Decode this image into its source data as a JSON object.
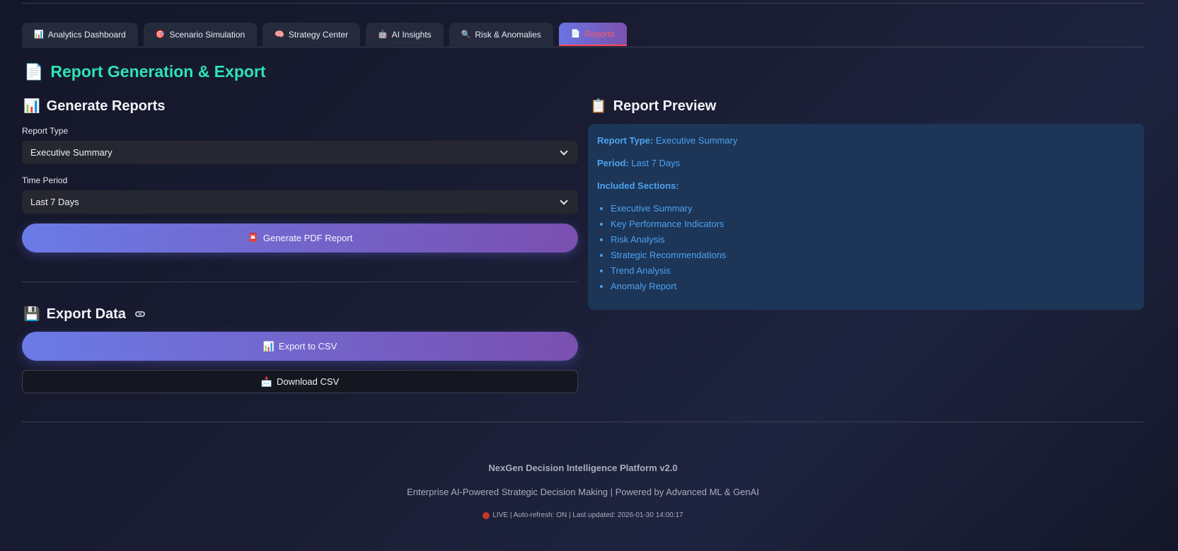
{
  "tabs": [
    {
      "icon": "📊",
      "label": "Analytics Dashboard"
    },
    {
      "icon": "🎯",
      "label": "Scenario Simulation"
    },
    {
      "icon": "🧠",
      "label": "Strategy Center"
    },
    {
      "icon": "🤖",
      "label": "AI Insights"
    },
    {
      "icon": "🔍",
      "label": "Risk & Anomalies"
    },
    {
      "icon": "📄",
      "label": "Reports"
    }
  ],
  "page_title": {
    "icon": "📄",
    "text": "Report Generation & Export"
  },
  "generate": {
    "heading_icon": "📊",
    "heading": "Generate Reports",
    "report_type_label": "Report Type",
    "report_type_value": "Executive Summary",
    "time_period_label": "Time Period",
    "time_period_value": "Last 7 Days",
    "pdf_button_icon": "📮",
    "pdf_button": "Generate PDF Report"
  },
  "export": {
    "heading_icon": "💾",
    "heading": "Export Data",
    "csv_button_icon": "📊",
    "csv_button": "Export to CSV",
    "download_button_icon": "📩",
    "download_button": "Download CSV"
  },
  "preview": {
    "heading_icon": "📋",
    "heading": "Report Preview",
    "report_type_key": "Report Type:",
    "report_type_val": "Executive Summary",
    "period_key": "Period:",
    "period_val": "Last 7 Days",
    "sections_key": "Included Sections:",
    "sections": [
      "Executive Summary",
      "Key Performance Indicators",
      "Risk Analysis",
      "Strategic Recommendations",
      "Trend Analysis",
      "Anomaly Report"
    ]
  },
  "footer": {
    "title": "NexGen Decision Intelligence Platform v2.0",
    "subtitle": "Enterprise AI-Powered Strategic Decision Making | Powered by Advanced ML & GenAI",
    "status": "LIVE | Auto-refresh: ON | Last updated: 2026-01-30 14:00:17"
  },
  "colors": {
    "accent": "#2ee3b4",
    "active_tab_text": "#ff5a6a",
    "preview_text": "#4da3f0",
    "live_dot": "#c0392b"
  }
}
